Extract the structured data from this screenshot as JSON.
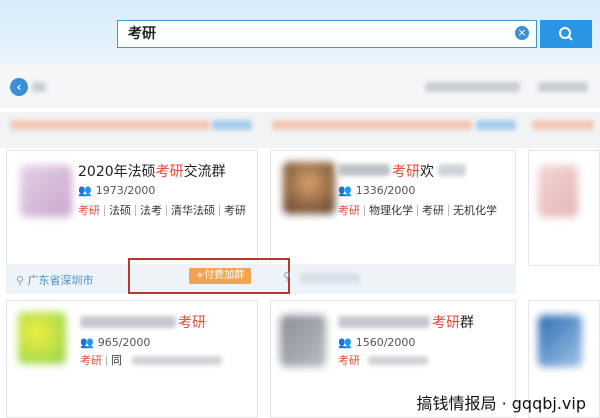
{
  "search": {
    "query": "考研",
    "clear_icon": "close-circle-icon",
    "search_icon": "magnifier-icon"
  },
  "nav": {
    "back_icon": "arrow-left-icon"
  },
  "cards": [
    {
      "title_prefix": "2020年法硕",
      "title_highlight": "考研",
      "title_suffix": "交流群",
      "members": "1973/2000",
      "tags": [
        "考研",
        "法硕",
        "法考",
        "清华法硕",
        "考研"
      ],
      "location": "广东省深圳市"
    },
    {
      "title_prefix": "",
      "title_highlight": "考研",
      "title_suffix": "欢",
      "members": "1336/2000",
      "tags": [
        "考研",
        "物理化学",
        "考研",
        "无机化学"
      ]
    },
    {
      "title_prefix": "",
      "title_highlight": "考研",
      "title_suffix": "",
      "members": "965/2000",
      "tags": [
        "考研",
        "同"
      ]
    },
    {
      "title_prefix": "",
      "title_highlight": "考研",
      "title_suffix": "群",
      "members": "1560/2000",
      "tags": [
        "考研"
      ]
    }
  ],
  "join_button": "+付费加群",
  "watermark": "搞钱情报局 · gqqbj.vip",
  "colors": {
    "accent": "#2a95e3",
    "highlight": "#e24a35",
    "join": "#f2a352",
    "annotation_box": "#b23a2a"
  }
}
